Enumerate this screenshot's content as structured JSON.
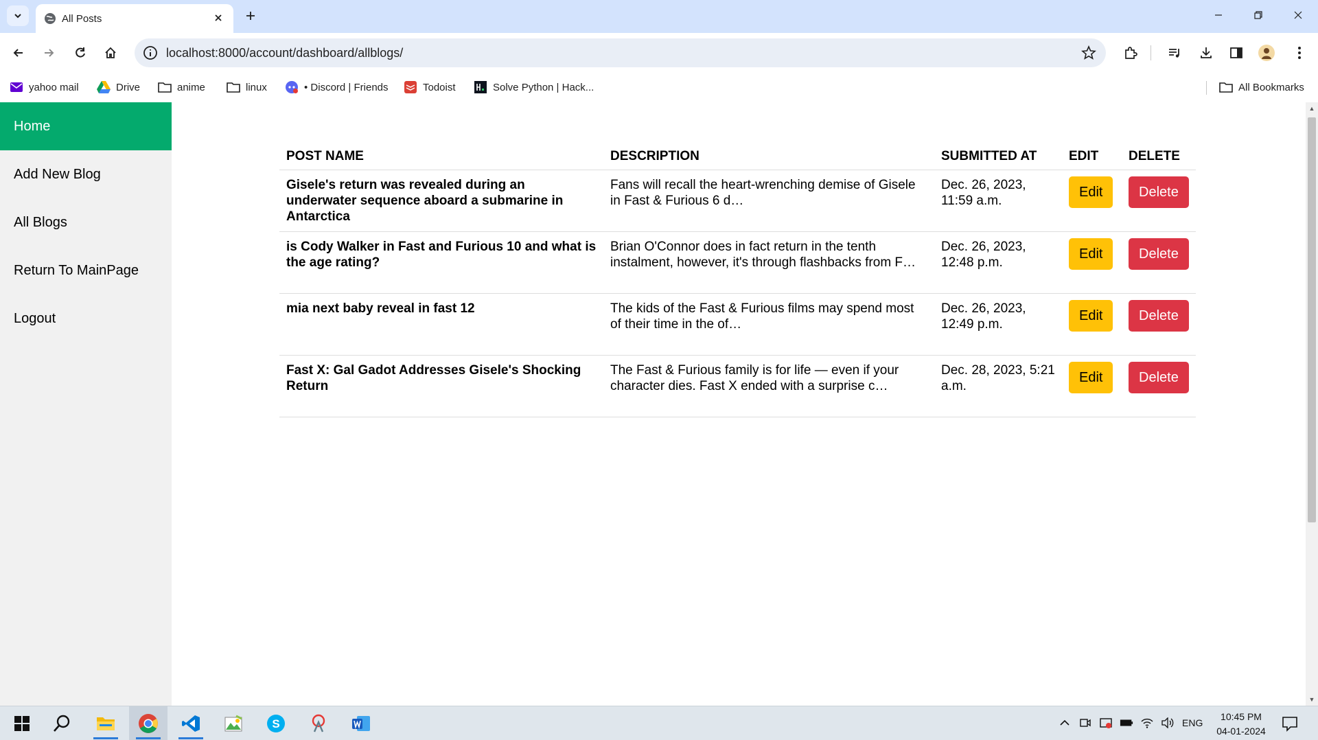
{
  "browser": {
    "tab_title": "All Posts",
    "url": "localhost:8000/account/dashboard/allblogs/",
    "bookmarks": [
      {
        "label": "yahoo mail",
        "icon": "mail-icon"
      },
      {
        "label": "Drive",
        "icon": "drive-icon"
      },
      {
        "label": "anime",
        "icon": "folder-icon"
      },
      {
        "label": "linux",
        "icon": "folder-icon"
      },
      {
        "label": "• Discord | Friends",
        "icon": "discord-icon"
      },
      {
        "label": "Todoist",
        "icon": "todoist-icon"
      },
      {
        "label": "Solve Python | Hack...",
        "icon": "hackerrank-icon"
      }
    ],
    "all_bookmarks": "All Bookmarks"
  },
  "sidebar": {
    "items": [
      {
        "label": "Home",
        "active": true
      },
      {
        "label": "Add New Blog"
      },
      {
        "label": "All Blogs"
      },
      {
        "label": "Return To MainPage"
      },
      {
        "label": "Logout"
      }
    ]
  },
  "table": {
    "headers": {
      "name": "POST NAME",
      "description": "DESCRIPTION",
      "submitted": "SUBMITTED AT",
      "edit": "EDIT",
      "delete": "DELETE"
    },
    "edit_label": "Edit",
    "delete_label": "Delete",
    "rows": [
      {
        "name": "Gisele's return was revealed during an underwater sequence aboard a submarine in Antarctica",
        "description": "Fans will recall the heart-wrenching demise of Gisele in Fast & Furious 6 d…",
        "submitted": "Dec. 26, 2023, 11:59 a.m."
      },
      {
        "name": "is Cody Walker in Fast and Furious 10 and what is the age rating?",
        "description": "Brian O'Connor does in fact return in the tenth instalment, however, it's through flashbacks from F…",
        "submitted": "Dec. 26, 2023, 12:48 p.m."
      },
      {
        "name": "mia next baby reveal in fast 12",
        "description": "The kids of the Fast & Furious films may spend most of their time in the of…",
        "submitted": "Dec. 26, 2023, 12:49 p.m."
      },
      {
        "name": "Fast X: Gal Gadot Addresses Gisele's Shocking Return",
        "description": "The Fast & Furious family is for life — even if your character dies. Fast X ended with a surprise c…",
        "submitted": "Dec. 28, 2023, 5:21 a.m."
      }
    ]
  },
  "taskbar": {
    "apps": [
      "windows-start-icon",
      "search-icon",
      "file-explorer-icon",
      "chrome-icon",
      "vscode-icon",
      "photos-icon",
      "skype-icon",
      "snipping-tool-icon",
      "word-icon"
    ],
    "language": "ENG",
    "time": "10:45 PM",
    "date": "04-01-2024"
  },
  "colors": {
    "sidebar_active": "#04aa6d",
    "edit_button": "#ffc107",
    "delete_button": "#dc3545",
    "tabbar": "#d3e3fd"
  }
}
